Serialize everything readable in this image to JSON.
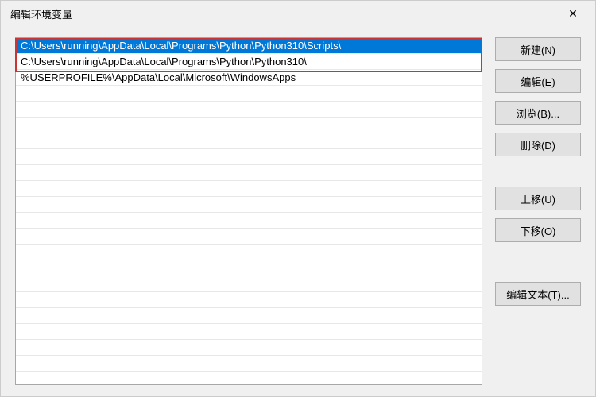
{
  "dialog": {
    "title": "编辑环境变量",
    "close_symbol": "✕"
  },
  "list": {
    "items": [
      {
        "path": "C:\\Users\\running\\AppData\\Local\\Programs\\Python\\Python310\\Scripts\\",
        "selected": true
      },
      {
        "path": "C:\\Users\\running\\AppData\\Local\\Programs\\Python\\Python310\\",
        "selected": false
      },
      {
        "path": "%USERPROFILE%\\AppData\\Local\\Microsoft\\WindowsApps",
        "selected": false
      }
    ]
  },
  "buttons": {
    "new": "新建(N)",
    "edit": "编辑(E)",
    "browse": "浏览(B)...",
    "delete": "删除(D)",
    "move_up": "上移(U)",
    "move_down": "下移(O)",
    "edit_text": "编辑文本(T)..."
  }
}
